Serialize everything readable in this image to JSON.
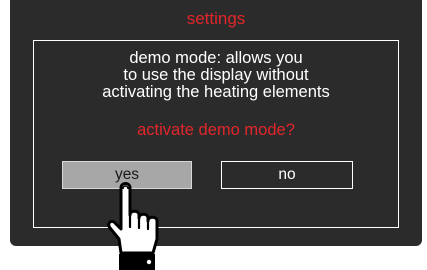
{
  "screen": {
    "title": "settings"
  },
  "dialog": {
    "message_lines": [
      "demo mode: allows you",
      "to use the display without",
      "activating the heating elements"
    ],
    "question": "activate demo mode?",
    "yes_label": "yes",
    "no_label": "no"
  },
  "colors": {
    "display_background": "#2b2b2b",
    "accent_red": "#e2262b",
    "text_white": "#ffffff",
    "yes_button_fill": "#a7a7a7"
  },
  "icons": {
    "pointer": "pointing-hand-icon"
  }
}
